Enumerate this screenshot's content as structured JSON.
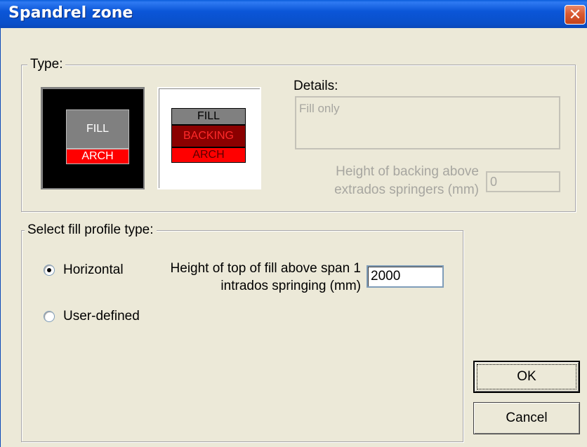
{
  "window": {
    "title": "Spandrel zone",
    "close_symbol": "✕"
  },
  "type_group": {
    "legend": "Type:",
    "tiles": [
      {
        "layers": [
          "FILL",
          "ARCH"
        ],
        "selected": true
      },
      {
        "layers": [
          "FILL",
          "BACKING",
          "ARCH"
        ],
        "selected": false
      }
    ],
    "details_label": "Details:",
    "details_text": "Fill only",
    "backing_label_line1": "Height of backing above",
    "backing_label_line2": "extrados springers (mm)",
    "backing_value": "0"
  },
  "profile_group": {
    "legend": "Select fill profile type:",
    "options": [
      {
        "label": "Horizontal",
        "checked": true
      },
      {
        "label": "User-defined",
        "checked": false
      }
    ],
    "fill_label_line1": "Height of top of fill above span 1",
    "fill_label_line2": "intrados springing (mm)",
    "fill_value": "2000"
  },
  "buttons": {
    "ok": "OK",
    "cancel": "Cancel"
  },
  "colors": {
    "fill": "#808080",
    "backing": "#8b0000",
    "arch": "#ff0000",
    "title_bar": "#0a5ddb"
  }
}
